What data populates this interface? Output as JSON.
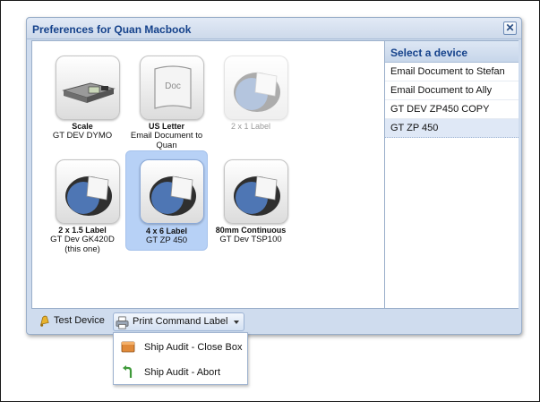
{
  "dialog": {
    "title": "Preferences for Quan Macbook",
    "close_glyph": "✕"
  },
  "devices": [
    {
      "name": "Scale",
      "sub": "GT DEV DYMO",
      "icon": "scale-icon",
      "state": "normal"
    },
    {
      "name": "US Letter",
      "sub": "Email Document to Quan",
      "icon": "document-icon",
      "state": "normal"
    },
    {
      "name": "2 x 1 Label",
      "sub": "",
      "icon": "label-printer-icon",
      "state": "disabled"
    },
    {
      "name": "2 x 1.5 Label",
      "sub": "GT Dev GK420D (this one)",
      "icon": "label-printer-icon",
      "state": "normal"
    },
    {
      "name": "4 x 6 Label",
      "sub": "GT ZP 450",
      "icon": "label-printer-icon",
      "state": "selected"
    },
    {
      "name": "80mm Continuous",
      "sub": "GT Dev TSP100",
      "icon": "label-printer-icon",
      "state": "normal"
    }
  ],
  "document_icon_text": "Doc",
  "sidebar": {
    "header": "Select a device",
    "items": [
      {
        "label": "Email Document to Stefan"
      },
      {
        "label": "Email Document to Ally"
      },
      {
        "label": "GT DEV ZP450 COPY"
      },
      {
        "label": "GT ZP 450",
        "selected": true
      }
    ]
  },
  "toolbar": {
    "test_label": "Test Device",
    "print_label": "Print Command Label"
  },
  "menu": {
    "items": [
      {
        "label": "Ship Audit - Close Box",
        "icon": "box-icon"
      },
      {
        "label": "Ship Audit - Abort",
        "icon": "return-arrow-icon"
      }
    ]
  },
  "colors": {
    "title_text": "#15428b",
    "selected_tile": "#b7d1f6",
    "dialog_bg": "#cfdcee"
  }
}
